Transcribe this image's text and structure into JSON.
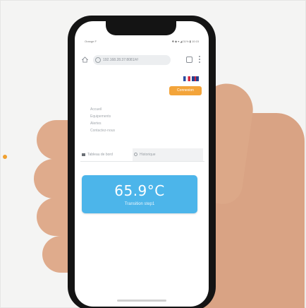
{
  "status_bar": {
    "left": "Orange F",
    "right": "✱ ◆ ▾ ◢ 31% ▮ 10:15"
  },
  "browser": {
    "url": "192.168.28.37:8081/#/",
    "tab_count": ""
  },
  "header": {
    "login_label": "Connexion",
    "languages": [
      "fr",
      "en"
    ]
  },
  "nav": {
    "items": [
      "Accueil",
      "Equipements",
      "Alertes",
      "Contactez-nous"
    ]
  },
  "tabs": {
    "items": [
      {
        "label": "Tableau de bord",
        "active": true
      },
      {
        "label": "Historique",
        "active": false
      }
    ]
  },
  "temperature_card": {
    "value": "65.9°C",
    "status": "Transition step1",
    "color": "#4cb5ea"
  },
  "colors": {
    "accent_orange": "#f3a43a",
    "card_blue": "#4cb5ea"
  }
}
